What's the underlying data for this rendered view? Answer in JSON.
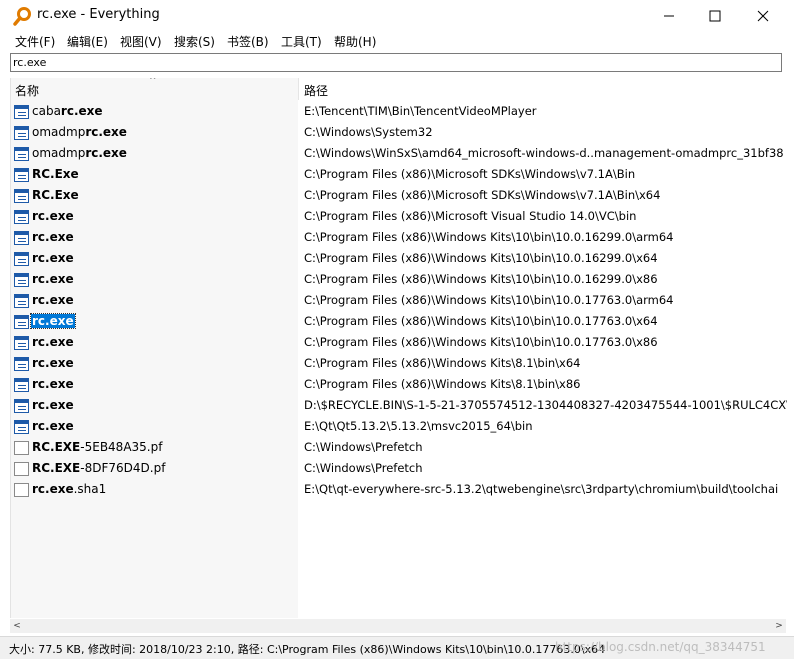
{
  "window": {
    "title": "rc.exe - Everything"
  },
  "menu": [
    "文件(F)",
    "编辑(E)",
    "视图(V)",
    "搜索(S)",
    "书签(B)",
    "工具(T)",
    "帮助(H)"
  ],
  "search": {
    "value": "rc.exe"
  },
  "columns": {
    "name": "名称",
    "path": "路径"
  },
  "rows": [
    {
      "pre": "caba",
      "match": "rc.exe",
      "post": "",
      "path": "E:\\Tencent\\TIM\\Bin\\TencentVideoMPlayer",
      "icon": "exe"
    },
    {
      "pre": "omadmp",
      "match": "rc.exe",
      "post": "",
      "path": "C:\\Windows\\System32",
      "icon": "exe"
    },
    {
      "pre": "omadmp",
      "match": "rc.exe",
      "post": "",
      "path": "C:\\Windows\\WinSxS\\amd64_microsoft-windows-d..management-omadmprc_31bf38",
      "icon": "exe"
    },
    {
      "pre": "",
      "match": "RC.Exe",
      "post": "",
      "path": "C:\\Program Files (x86)\\Microsoft SDKs\\Windows\\v7.1A\\Bin",
      "icon": "exe"
    },
    {
      "pre": "",
      "match": "RC.Exe",
      "post": "",
      "path": "C:\\Program Files (x86)\\Microsoft SDKs\\Windows\\v7.1A\\Bin\\x64",
      "icon": "exe"
    },
    {
      "pre": "",
      "match": "rc.exe",
      "post": "",
      "path": "C:\\Program Files (x86)\\Microsoft Visual Studio 14.0\\VC\\bin",
      "icon": "exe"
    },
    {
      "pre": "",
      "match": "rc.exe",
      "post": "",
      "path": "C:\\Program Files (x86)\\Windows Kits\\10\\bin\\10.0.16299.0\\arm64",
      "icon": "exe"
    },
    {
      "pre": "",
      "match": "rc.exe",
      "post": "",
      "path": "C:\\Program Files (x86)\\Windows Kits\\10\\bin\\10.0.16299.0\\x64",
      "icon": "exe"
    },
    {
      "pre": "",
      "match": "rc.exe",
      "post": "",
      "path": "C:\\Program Files (x86)\\Windows Kits\\10\\bin\\10.0.16299.0\\x86",
      "icon": "exe"
    },
    {
      "pre": "",
      "match": "rc.exe",
      "post": "",
      "path": "C:\\Program Files (x86)\\Windows Kits\\10\\bin\\10.0.17763.0\\arm64",
      "icon": "exe"
    },
    {
      "pre": "",
      "match": "rc.exe",
      "post": "",
      "path": "C:\\Program Files (x86)\\Windows Kits\\10\\bin\\10.0.17763.0\\x64",
      "icon": "exe",
      "selected": true
    },
    {
      "pre": "",
      "match": "rc.exe",
      "post": "",
      "path": "C:\\Program Files (x86)\\Windows Kits\\10\\bin\\10.0.17763.0\\x86",
      "icon": "exe"
    },
    {
      "pre": "",
      "match": "rc.exe",
      "post": "",
      "path": "C:\\Program Files (x86)\\Windows Kits\\8.1\\bin\\x64",
      "icon": "exe"
    },
    {
      "pre": "",
      "match": "rc.exe",
      "post": "",
      "path": "C:\\Program Files (x86)\\Windows Kits\\8.1\\bin\\x86",
      "icon": "exe"
    },
    {
      "pre": "",
      "match": "rc.exe",
      "post": "",
      "path": "D:\\$RECYCLE.BIN\\S-1-5-21-3705574512-1304408327-4203475544-1001\\$RULC4CX\\",
      "icon": "exe"
    },
    {
      "pre": "",
      "match": "rc.exe",
      "post": "",
      "path": "E:\\Qt\\Qt5.13.2\\5.13.2\\msvc2015_64\\bin",
      "icon": "exe"
    },
    {
      "pre": "",
      "match": "RC.EXE",
      "post": "-5EB48A35.pf",
      "path": "C:\\Windows\\Prefetch",
      "icon": "file"
    },
    {
      "pre": "",
      "match": "RC.EXE",
      "post": "-8DF76D4D.pf",
      "path": "C:\\Windows\\Prefetch",
      "icon": "file"
    },
    {
      "pre": "",
      "match": "rc.exe",
      "post": ".sha1",
      "path": "E:\\Qt\\qt-everywhere-src-5.13.2\\qtwebengine\\src\\3rdparty\\chromium\\build\\toolchai",
      "icon": "file"
    }
  ],
  "status": {
    "text": "大小: 77.5 KB, 修改时间: 2018/10/23 2:10, 路径: C:\\Program Files (x86)\\Windows Kits\\10\\bin\\10.0.17763.0\\x64"
  },
  "watermark": "https://blog.csdn.net/qq_38344751"
}
